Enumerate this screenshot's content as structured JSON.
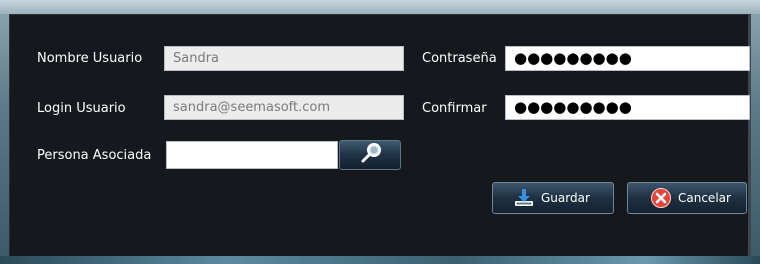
{
  "form": {
    "nombre_usuario_label": "Nombre Usuario",
    "nombre_usuario_value": "Sandra",
    "login_usuario_label": "Login Usuario",
    "login_usuario_value": "sandra@seemasoft.com",
    "persona_asociada_label": "Persona Asociada",
    "persona_asociada_value": "",
    "contrasena_label": "Contraseña",
    "contrasena_value": "●●●●●●●●●",
    "confirmar_label": "Confirmar",
    "confirmar_value": "●●●●●●●●●"
  },
  "actions": {
    "save_label": "Guardar",
    "cancel_label": "Cancelar"
  },
  "icons": {
    "search": "magnifier-icon",
    "save": "download-tray-icon",
    "cancel": "close-circle-icon"
  },
  "colors": {
    "panel_background": "#15191e",
    "cancel_icon": "#e0463c",
    "save_icon": "#3b8fe0"
  }
}
